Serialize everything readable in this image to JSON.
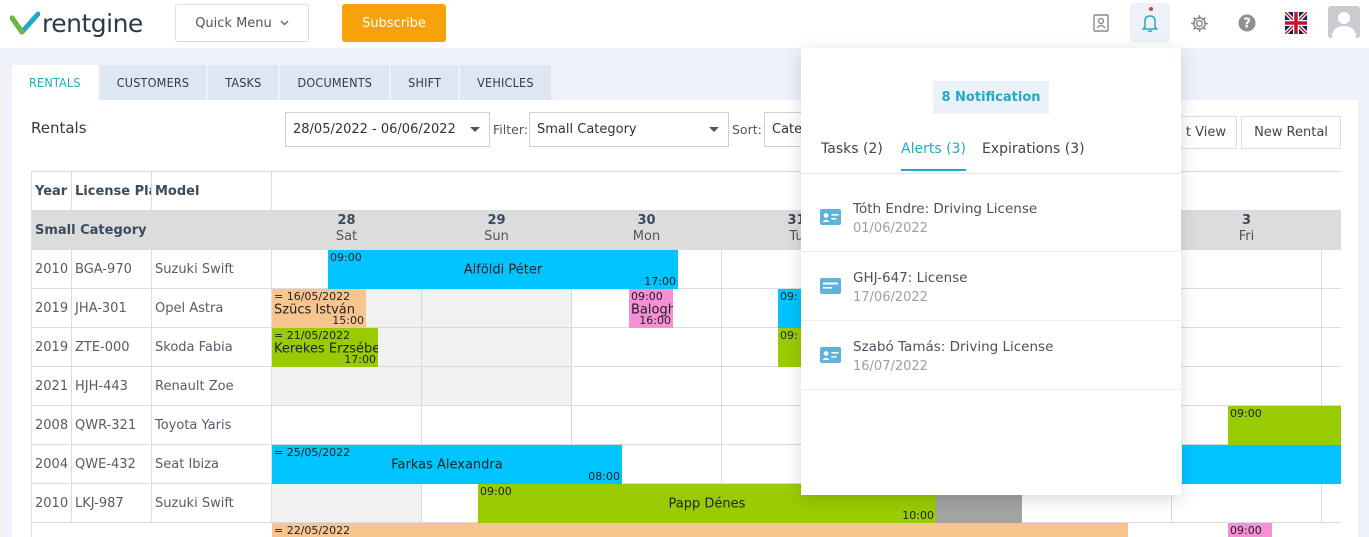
{
  "header": {
    "logo_text": "rentgine",
    "quick_menu_label": "Quick Menu",
    "subscribe_label": "Subscribe"
  },
  "tabs": [
    {
      "label": "RENTALS"
    },
    {
      "label": "CUSTOMERS"
    },
    {
      "label": "TASKS"
    },
    {
      "label": "DOCUMENTS"
    },
    {
      "label": "SHIFT"
    },
    {
      "label": "VEHICLES"
    }
  ],
  "panel": {
    "title": "Rentals",
    "date_range": "28/05/2022 - 06/06/2022",
    "filter_label": "Filter:",
    "filter_value": "Small Category",
    "sort_label": "Sort:",
    "sort_value": "Cate",
    "view_button": "t View",
    "new_rental_button": "New Rental"
  },
  "grid": {
    "col_year": "Year",
    "col_plate": "License Plat",
    "col_model": "Model",
    "category": "Small Category",
    "days": [
      {
        "num": "28",
        "name": "Sat"
      },
      {
        "num": "29",
        "name": "Sun"
      },
      {
        "num": "30",
        "name": "Mon"
      },
      {
        "num": "31",
        "name": "Tu"
      },
      {
        "num": "3",
        "name": "Fri"
      }
    ],
    "rows": [
      {
        "year": "2010",
        "plate": "BGA-970",
        "model": "Suzuki Swift"
      },
      {
        "year": "2019",
        "plate": "JHA-301",
        "model": "Opel Astra"
      },
      {
        "year": "2019",
        "plate": "ZTE-000",
        "model": "Skoda Fabia"
      },
      {
        "year": "2021",
        "plate": "HJH-443",
        "model": "Renault Zoe"
      },
      {
        "year": "2008",
        "plate": "QWR-321",
        "model": "Toyota Yaris"
      },
      {
        "year": "2004",
        "plate": "QWE-432",
        "model": "Seat Ibiza"
      },
      {
        "year": "2010",
        "plate": "LKJ-987",
        "model": "Suzuki Swift"
      }
    ],
    "bookings": [
      {
        "start": "09:00",
        "name": "Alföldi Péter",
        "end": "17:00",
        "color": "#00c4ff"
      },
      {
        "start": "= 16/05/2022",
        "name": "Szücs István",
        "end": "15:00",
        "color": "#f9c58f"
      },
      {
        "start": "09:00",
        "name": "Balogh",
        "end": "16:00",
        "color": "#f78fd6"
      },
      {
        "start": "09:",
        "name": "",
        "end": "",
        "color": "#00c4ff"
      },
      {
        "start": "= 21/05/2022",
        "name": "Kerekes Erzsébe",
        "end": "17:00",
        "color": "#99cc00"
      },
      {
        "start": "09:",
        "name": "",
        "end": "",
        "color": "#99cc00"
      },
      {
        "start": "09:00",
        "name": "",
        "end": "",
        "color": "#99cc00"
      },
      {
        "start": "= 25/05/2022",
        "name": "Farkas Alexandra",
        "end": "08:00",
        "color": "#00c4ff"
      },
      {
        "start": "",
        "name": "",
        "end": "",
        "color": "#00c4ff"
      },
      {
        "start": "09:00",
        "name": "Papp Dénes",
        "end": "10:00",
        "color": "#99cc00"
      },
      {
        "start": "",
        "name": "",
        "end": "",
        "color": "#a3a3a3"
      },
      {
        "start": "= 22/05/2022",
        "name": "",
        "end": "",
        "color": "#f9c58f"
      },
      {
        "start": "09:00",
        "name": "",
        "end": "",
        "color": "#f78fd6"
      }
    ]
  },
  "notifications": {
    "count_label": "8 Notification",
    "tabs": [
      {
        "label": "Tasks (2)"
      },
      {
        "label": "Alerts (3)"
      },
      {
        "label": "Expirations (3)"
      }
    ],
    "items": [
      {
        "title": "Tóth Endre: Driving License",
        "date": "01/06/2022",
        "icon": "id-card-icon"
      },
      {
        "title": "GHJ-647: License",
        "date": "17/06/2022",
        "icon": "license-card-icon"
      },
      {
        "title": "Szabó Tamás: Driving License",
        "date": "16/07/2022",
        "icon": "id-card-icon"
      }
    ]
  }
}
